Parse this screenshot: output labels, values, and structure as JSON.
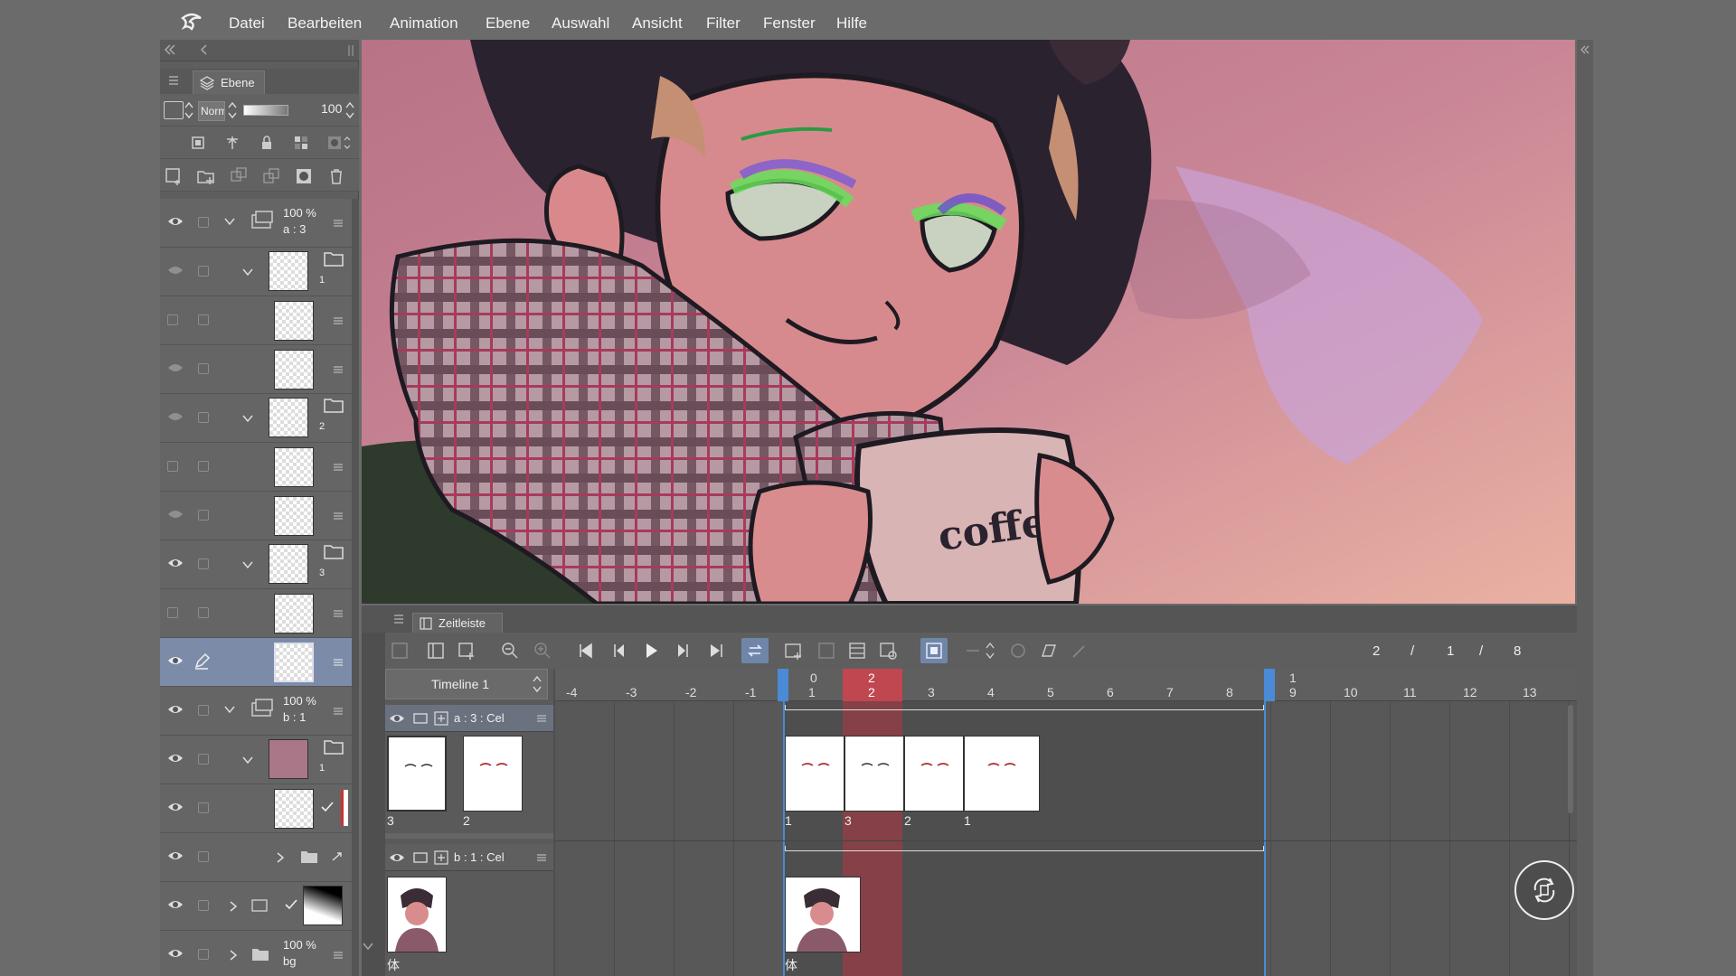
{
  "menu": {
    "items": [
      "Datei",
      "Bearbeiten",
      "Animation",
      "Ebene",
      "Auswahl",
      "Ansicht",
      "Filter",
      "Fenster",
      "Hilfe"
    ]
  },
  "layer_panel": {
    "tab_label": "Ebene",
    "blend_mode": "Norm",
    "opacity": "100",
    "layers": [
      {
        "opacity": "100 %",
        "name": "a : 3"
      },
      {
        "label": "1"
      },
      {
        "label": "2"
      },
      {
        "label": "3"
      },
      {
        "opacity": "100 %",
        "name": "b : 1"
      },
      {
        "label": "1"
      },
      {
        "opacity": "100 %",
        "name": "bg"
      }
    ]
  },
  "timeline": {
    "tab_label": "Zeitleiste",
    "timeline_name": "Timeline 1",
    "counter": {
      "current": "2",
      "sep1": "/",
      "mid": "1",
      "sep2": "/",
      "total": "8"
    },
    "ruler_top": [
      "0",
      "2",
      "1"
    ],
    "ruler_bottom": [
      "-4",
      "-3",
      "-2",
      "-1",
      "1",
      "2",
      "3",
      "4",
      "5",
      "6",
      "7",
      "8",
      "9",
      "10",
      "11",
      "12",
      "13"
    ],
    "tracks": [
      {
        "name": "a : 3 : Cel",
        "left_cels": [
          "3",
          "2"
        ],
        "cel_labels": [
          "1",
          "3",
          "2",
          "1"
        ]
      },
      {
        "name": "b : 1 : Cel",
        "left_cels": [
          "体"
        ],
        "cel_labels": [
          "体"
        ]
      }
    ]
  },
  "canvas": {
    "mug_text": "coffee"
  },
  "colors": {
    "selected_frame": "#c0474f",
    "selected_layer": "#7c8ca8",
    "timeline_marker": "#4a8ad6"
  }
}
